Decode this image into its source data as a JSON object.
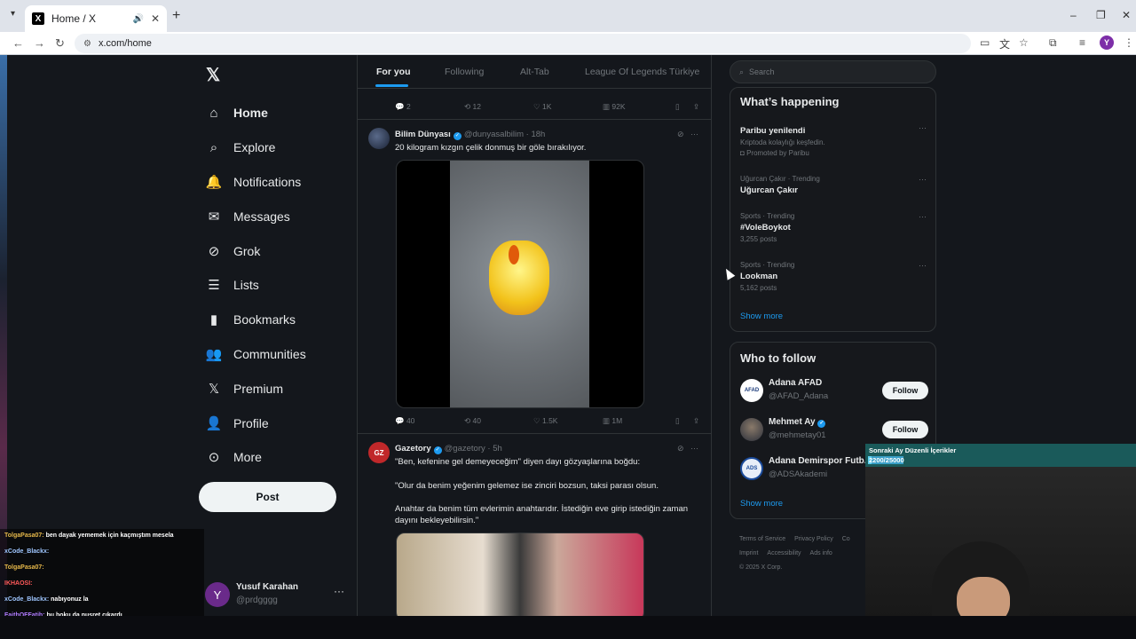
{
  "browser": {
    "tab_title": "Home / X",
    "tab_favicon": "X",
    "url": "x.com/home",
    "profile_initial": "Y"
  },
  "sidebar": {
    "items": [
      {
        "label": "Home",
        "icon": "home-icon",
        "glyph": "⌂",
        "active": true
      },
      {
        "label": "Explore",
        "icon": "search-icon",
        "glyph": "⌕",
        "active": false
      },
      {
        "label": "Notifications",
        "icon": "bell-icon",
        "glyph": "🔔",
        "active": false
      },
      {
        "label": "Messages",
        "icon": "envelope-icon",
        "glyph": "✉",
        "active": false
      },
      {
        "label": "Grok",
        "icon": "grok-icon",
        "glyph": "⊘",
        "active": false
      },
      {
        "label": "Lists",
        "icon": "list-icon",
        "glyph": "☰",
        "active": false
      },
      {
        "label": "Bookmarks",
        "icon": "bookmark-icon",
        "glyph": "▮",
        "active": false
      },
      {
        "label": "Communities",
        "icon": "communities-icon",
        "glyph": "👥",
        "active": false
      },
      {
        "label": "Premium",
        "icon": "x-premium-icon",
        "glyph": "𝕏",
        "active": false
      },
      {
        "label": "Profile",
        "icon": "person-icon",
        "glyph": "👤",
        "active": false
      },
      {
        "label": "More",
        "icon": "more-circle-icon",
        "glyph": "⊙",
        "active": false
      }
    ],
    "post_label": "Post",
    "account": {
      "initial": "Y",
      "name": "Yusuf Karahan",
      "handle": "@prdgggg"
    }
  },
  "feed": {
    "tabs": [
      "For you",
      "Following",
      "Alt-Tab",
      "League Of Legends Türkiye"
    ],
    "top_actions": {
      "replies": "2",
      "reposts": "12",
      "likes": "1K",
      "views": "92K"
    },
    "tweets": [
      {
        "name": "Bilim Dünyası",
        "handle": "@dunyasalbilim",
        "time": "· 18h",
        "text": "20 kilogram kızgın çelik donmuş bir göle bırakılıyor.",
        "replies": "40",
        "reposts": "40",
        "likes": "1.5K",
        "views": "1M"
      },
      {
        "name": "Gazetory",
        "handle": "@gazetory",
        "time": "· 5h",
        "avatar_text": "GZ",
        "text_lines": [
          "\"Ben, kefenine gel demeyeceğim\" diyen dayı gözyaşlarına boğdu:",
          "\"Olur da benim yeğenim gelemez ise zinciri bozsun, taksi parası olsun.",
          "Anahtar da benim tüm evlerimin anahtarıdır. İstediğin eve girip istediğin zaman dayını bekleyebilirsin.\""
        ]
      }
    ]
  },
  "right": {
    "search_placeholder": "Search",
    "happening_title": "What’s happening",
    "trends": [
      {
        "meta": "",
        "title": "Paribu yenilendi",
        "sub": "Kriptoda kolaylığı keşfedin.",
        "promo": "Promoted by Paribu"
      },
      {
        "meta": "Uğurcan Çakır · Trending",
        "title": "Uğurcan Çakır",
        "sub": ""
      },
      {
        "meta": "Sports · Trending",
        "title": "#VoleBoykot",
        "sub": "3,255 posts"
      },
      {
        "meta": "Sports · Trending",
        "title": "Lookman",
        "sub": "5,162 posts"
      }
    ],
    "show_more": "Show more",
    "wtf_title": "Who to follow",
    "follow": [
      {
        "name": "Adana AFAD",
        "handle": "@AFAD_Adana",
        "button": "Follow",
        "avatar_text": "AFAD"
      },
      {
        "name": "Mehmet Ay",
        "handle": "@mehmetay01",
        "button": "Follow",
        "avatar_text": ""
      },
      {
        "name": "Adana Demirspor Futb...",
        "handle": "@ADSAkademi",
        "button": "",
        "avatar_text": "ADS"
      }
    ],
    "footer": [
      "Terms of Service",
      "Privacy Policy",
      "Co",
      "Imprint",
      "Accessibility",
      "Ads info",
      "© 2025 X Corp."
    ]
  },
  "overlay": {
    "chat": [
      {
        "user": "TolgaPasa07:",
        "msg": "ben dayak yememek için kaçmıştım mesela",
        "color": "#e6b84a"
      },
      {
        "user": "xCode_Blackx:",
        "msg": "",
        "color": "#9fc6ff"
      },
      {
        "user": "TolgaPasa07:",
        "msg": "",
        "color": "#e6b84a"
      },
      {
        "user": "IKHAOSI:",
        "msg": "",
        "color": "#ff5a5a"
      },
      {
        "user": "xCode_Blackx:",
        "msg": "nabıyonuz la",
        "color": "#9fc6ff"
      },
      {
        "user": "FaithOFFatih:",
        "msg": "bu boku da nusret çıkardı",
        "color": "#b07cff"
      }
    ],
    "banner_title": "Sonraki Ay Düzenli İçerikler",
    "banner_progress": "2200/25000",
    "banner_fraction": 0.088
  }
}
